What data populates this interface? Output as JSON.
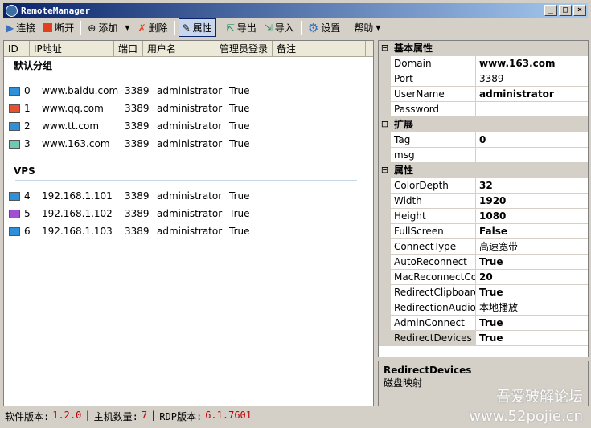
{
  "window": {
    "title": "RemoteManager",
    "min": "_",
    "max": "□",
    "close": "×"
  },
  "toolbar": {
    "connect": "连接",
    "disconnect": "断开",
    "add": "添加",
    "delete": "删除",
    "properties": "属性",
    "export": "导出",
    "import": "导入",
    "settings": "设置",
    "help": "帮助"
  },
  "colors": {
    "connect": "#3a70c0",
    "disconnect": "#e04020"
  },
  "list": {
    "columns": [
      "ID",
      "IP地址",
      "端口",
      "用户名",
      "管理员登录",
      "备注"
    ],
    "groups": [
      {
        "name": "默认分组",
        "rows": [
          {
            "id": "0",
            "ip": "www.baidu.com",
            "port": "3389",
            "user": "administrator",
            "admin": "True",
            "color": "#2f8fd8"
          },
          {
            "id": "1",
            "ip": "www.qq.com",
            "port": "3389",
            "user": "administrator",
            "admin": "True",
            "color": "#e85030"
          },
          {
            "id": "2",
            "ip": "www.tt.com",
            "port": "3389",
            "user": "administrator",
            "admin": "True",
            "color": "#2f8fd8"
          },
          {
            "id": "3",
            "ip": "www.163.com",
            "port": "3389",
            "user": "administrator",
            "admin": "True",
            "color": "#70c8b0"
          }
        ]
      },
      {
        "name": "VPS",
        "rows": [
          {
            "id": "4",
            "ip": "192.168.1.101",
            "port": "3389",
            "user": "administrator",
            "admin": "True",
            "color": "#2f8fd8"
          },
          {
            "id": "5",
            "ip": "192.168.1.102",
            "port": "3389",
            "user": "administrator",
            "admin": "True",
            "color": "#a050d0"
          },
          {
            "id": "6",
            "ip": "192.168.1.103",
            "port": "3389",
            "user": "administrator",
            "admin": "True",
            "color": "#2f8fd8"
          }
        ]
      }
    ]
  },
  "props": [
    {
      "cat": "基本属性",
      "items": [
        [
          "Domain",
          "www.163.com",
          true
        ],
        [
          "Port",
          "3389",
          false
        ],
        [
          "UserName",
          "administrator",
          true
        ],
        [
          "Password",
          "",
          false
        ]
      ]
    },
    {
      "cat": "扩展",
      "items": [
        [
          "Tag",
          "0",
          true
        ],
        [
          "msg",
          "",
          false
        ]
      ]
    },
    {
      "cat": "属性",
      "items": [
        [
          "ColorDepth",
          "32",
          true
        ],
        [
          "Width",
          "1920",
          true
        ],
        [
          "Height",
          "1080",
          true
        ],
        [
          "FullScreen",
          "False",
          true
        ],
        [
          "ConnectType",
          "高速宽带",
          false
        ],
        [
          "AutoReconnect",
          "True",
          true
        ],
        [
          "MacReconnectCo",
          "20",
          true
        ],
        [
          "RedirectClipboard",
          "True",
          true
        ],
        [
          "RedirectionAudio",
          "本地播放",
          false
        ],
        [
          "AdminConnect",
          "True",
          true
        ],
        [
          "RedirectDevices",
          "True",
          true
        ]
      ]
    }
  ],
  "description": {
    "title": "RedirectDevices",
    "text": "磁盘映射"
  },
  "watermark": {
    "line1": "吾爱破解论坛",
    "line2": "www.52pojie.cn"
  },
  "status": {
    "ver_label": "软件版本:",
    "ver": "1.2.0",
    "hosts_label": "主机数量:",
    "hosts": "7",
    "rdp_label": "RDP版本:",
    "rdp": "6.1.7601",
    "sep": "|"
  }
}
